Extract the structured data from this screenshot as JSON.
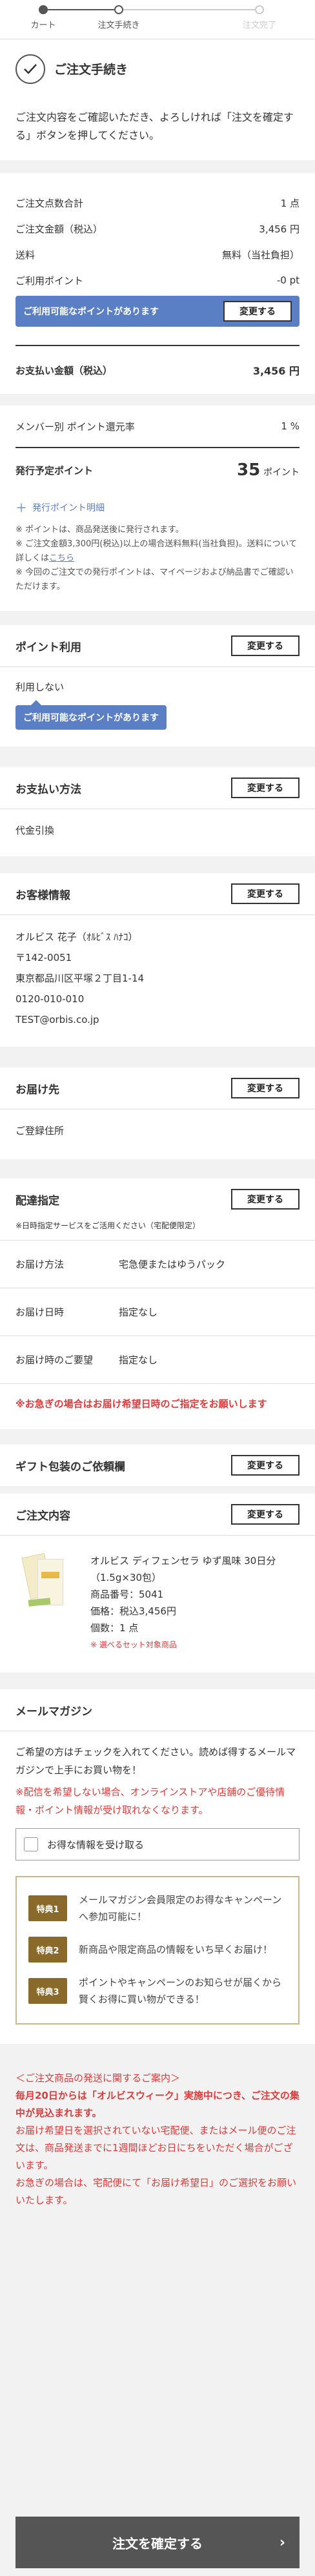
{
  "stepper": {
    "steps": [
      "カート",
      "注文手続き",
      "注文完了"
    ]
  },
  "heading": {
    "title": "ご注文手続き"
  },
  "intro": {
    "text": "ご注文内容をご確認いただき、よろしければ「注文を確定する」ボタンを押してください。"
  },
  "summary": {
    "count_label": "ご注文点数合計",
    "count_value": "1 点",
    "amount_label": "ご注文金額（税込）",
    "amount_value": "3,456 円",
    "shipping_label": "送料",
    "shipping_value": "無料（当社負担）",
    "points_label": "ご利用ポイント",
    "points_value": "-0 pt",
    "points_available": "ご利用可能なポイントがあります",
    "change_label": "変更する",
    "total_label": "お支払い金額（税込）",
    "total_value": "3,456 円"
  },
  "points_info": {
    "rate_label": "メンバー別 ポイント還元率",
    "rate_value": "1 %",
    "planned_label": "発行予定ポイント",
    "planned_value": "35",
    "planned_unit": "ポイント",
    "detail_link": "発行ポイント明細",
    "note1": "※ ポイントは、商品発送後に発行されます。",
    "note2": "※ ご注文金額3,300円(税込)以上の場合送料無料(当社負担)。送料について詳しくは",
    "note2_link": "こちら",
    "note3": "※ 今回のご注文での発行ポイントは、マイページおよび納品書でご確認いただけます。"
  },
  "point_use": {
    "title": "ポイント利用",
    "change": "変更する",
    "value": "利用しない",
    "available": "ご利用可能なポイントがあります"
  },
  "payment": {
    "title": "お支払い方法",
    "change": "変更する",
    "value": "代金引換"
  },
  "customer": {
    "title": "お客様情報",
    "change": "変更する",
    "name": "オルビス 花子（ｵﾙﾋﾞｽ ﾊﾅｺ）",
    "zip": "〒142-0051",
    "address": "東京都品川区平塚２丁目1-14",
    "phone": "0120-010-010",
    "email": "TEST@orbis.co.jp"
  },
  "destination": {
    "title": "お届け先",
    "change": "変更する",
    "value": "ご登録住所"
  },
  "delivery": {
    "title": "配達指定",
    "change": "変更する",
    "note": "※日時指定サービスをご活用ください（宅配便限定）",
    "rows": [
      {
        "k": "お届け方法",
        "v": "宅急便またはゆうパック"
      },
      {
        "k": "お届け日時",
        "v": "指定なし"
      },
      {
        "k": "お届け時のご要望",
        "v": "指定なし"
      }
    ],
    "warning": "※お急ぎの場合はお届け希望日時のご指定をお願いします"
  },
  "gift": {
    "title": "ギフト包装のご依頼欄",
    "change": "変更する"
  },
  "order": {
    "title": "ご注文内容",
    "change": "変更する",
    "product_name": "オルビス ディフェンセラ ゆず風味 30日分（1.5g×30包）",
    "product_no": "商品番号：5041",
    "price": "価格：税込3,456円",
    "qty": "個数：1 点",
    "set_note": "※ 選べるセット対象商品"
  },
  "mail": {
    "title": "メールマガジン",
    "desc": "ご希望の方はチェックを入れてください。読めば得するメールマガジンで上手にお買い物を！",
    "warning": "※配信を希望しない場合、オンラインストアや店舗のご優待情報・ポイント情報が受け取れなくなります。",
    "checkbox_label": "お得な情報を受け取る",
    "features": [
      {
        "badge": "特典1",
        "text": "メールマガジン会員限定のお得なキャンペーンへ参加可能に！"
      },
      {
        "badge": "特典2",
        "text": "新商品や限定商品の情報をいち早くお届け！"
      },
      {
        "badge": "特典3",
        "text": "ポイントやキャンペーンのお知らせが届くから賢くお得に買い物ができる！"
      }
    ]
  },
  "notice": {
    "lines": [
      "＜ご注文商品の発送に関するご案内＞",
      "毎月20日からは「オルビスウィーク」実施中につき、ご注文の集中が見込まれます。",
      "お届け希望日を選択されていない宅配便、またはメール便のご注文は、商品発送までに1週間ほどお日にちをいただく場合がございます。",
      "お急ぎの場合は、宅配便にて「お届け希望日」のご選択をお願いいたします。"
    ]
  },
  "confirm": {
    "label": "注文を確定する"
  }
}
